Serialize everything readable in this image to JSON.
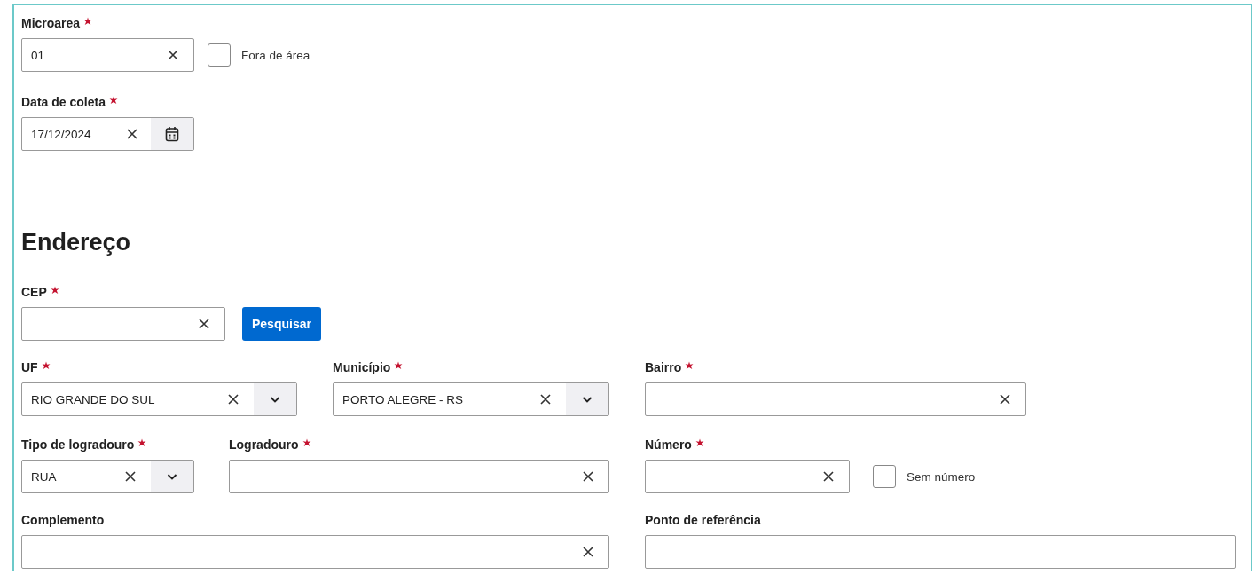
{
  "rows": [
    [
      {
        "kind": "field",
        "label": "Microarea",
        "required": true,
        "value": "01",
        "clearable": true
      },
      {
        "kind": "checkbox",
        "label": "Fora de área",
        "checked": false
      }
    ],
    [
      {
        "kind": "date",
        "label": "Data de coleta",
        "required": true,
        "value": "17/12/2024",
        "clearable": true
      }
    ],
    [
      {
        "kind": "heading",
        "label": "Endereço"
      }
    ],
    [
      {
        "kind": "field",
        "label": "CEP",
        "required": true,
        "clearable": true
      },
      {
        "kind": "button",
        "label": "Pesquisar"
      }
    ],
    [
      {
        "kind": "select",
        "label": "UF",
        "required": true,
        "value": "RIO GRANDE DO SUL",
        "clearable": true
      },
      {
        "kind": "select",
        "label": "Município",
        "required": true,
        "value": "PORTO ALEGRE - RS",
        "clearable": true
      },
      {
        "kind": "field",
        "label": "Bairro",
        "required": true,
        "clearable": true
      }
    ],
    [
      {
        "kind": "select",
        "label": "Tipo de logradouro",
        "required": true,
        "value": "RUA",
        "clearable": true
      },
      {
        "kind": "field",
        "label": "Logradouro",
        "required": true,
        "clearable": true
      },
      {
        "kind": "field",
        "label": "Número",
        "required": true,
        "clearable": true
      },
      {
        "kind": "checkbox",
        "label": "Sem número",
        "checked": false
      }
    ],
    [
      {
        "kind": "field",
        "label": "Complemento",
        "required": false,
        "clearable": true
      },
      {
        "kind": "field",
        "label": "Ponto de referência",
        "required": false,
        "clearable": false
      }
    ]
  ]
}
